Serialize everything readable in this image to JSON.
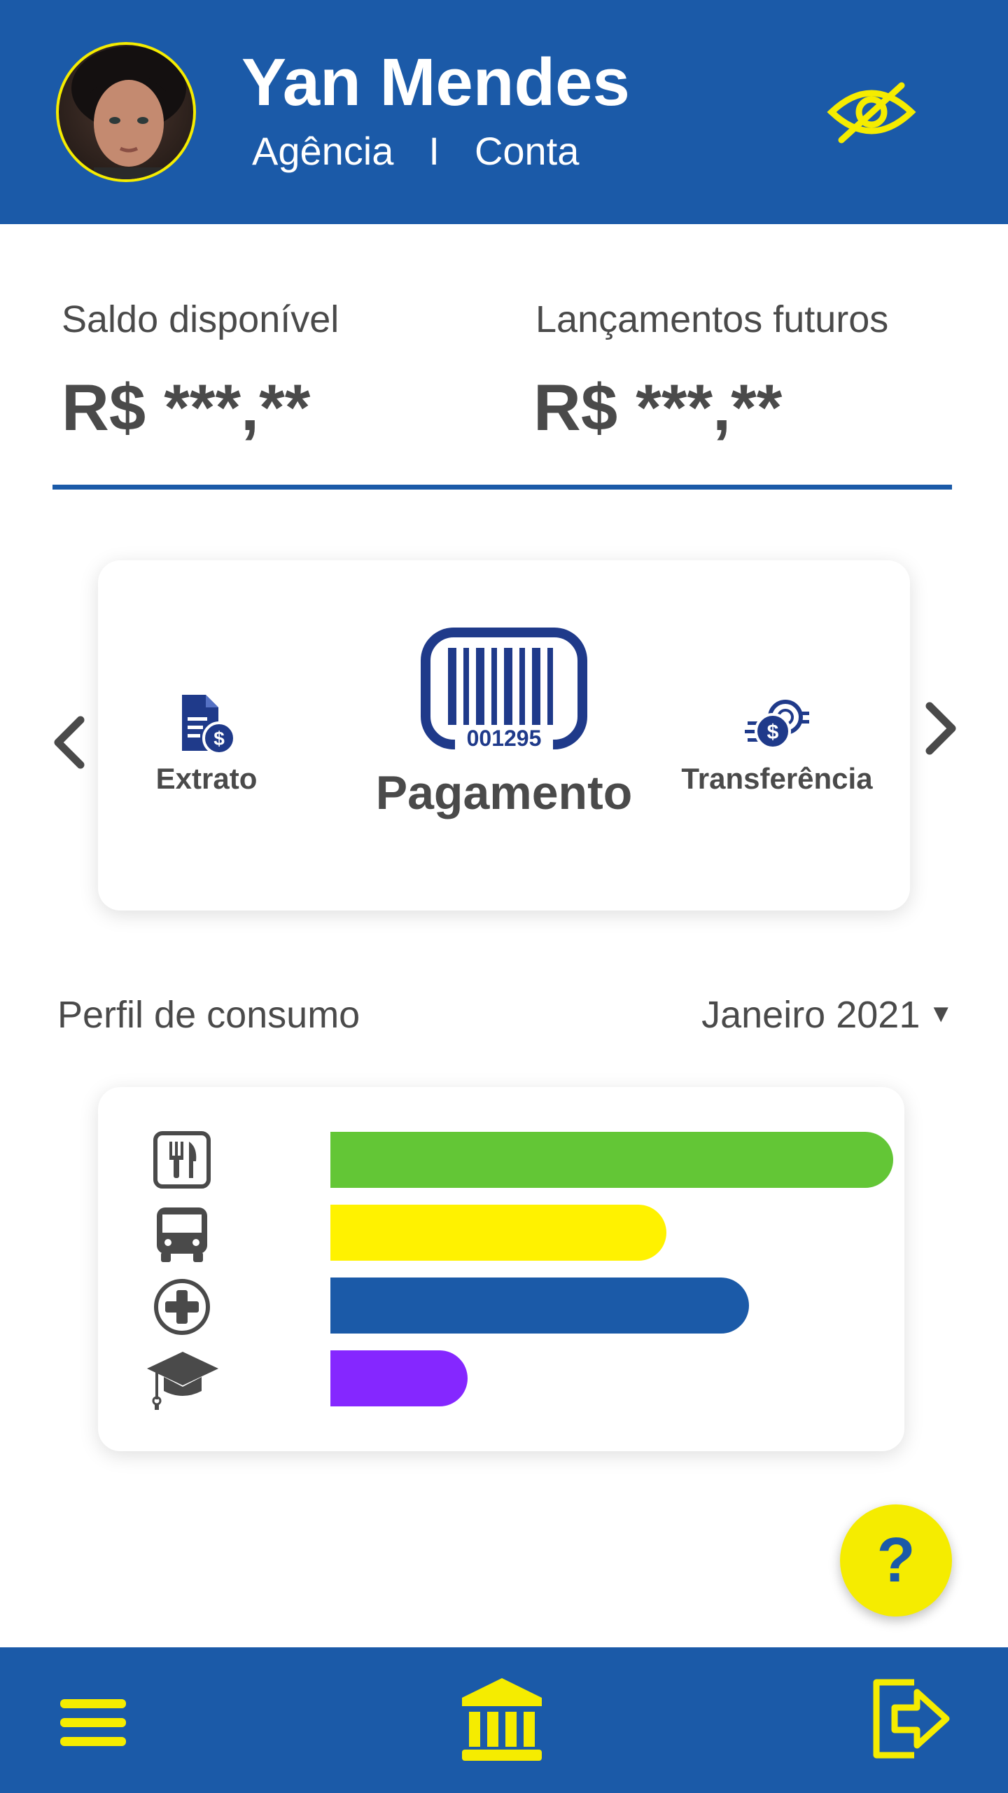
{
  "header": {
    "user_name": "Yan Mendes",
    "agency_label": "Agência",
    "separator": "I",
    "account_label": "Conta",
    "avatar_alt": "avatar",
    "visibility_icon": "eye-off-icon"
  },
  "balances": {
    "available": {
      "label": "Saldo disponível",
      "value": "R$ ***,**"
    },
    "future": {
      "label": "Lançamentos futuros",
      "value": "R$ ***,**"
    }
  },
  "actions": {
    "left_item": {
      "label": "Extrato",
      "icon": "statement-icon"
    },
    "center_item": {
      "label": "Pagamento",
      "icon": "barcode-icon",
      "barcode_number": "001295"
    },
    "right_item": {
      "label": "Transferência",
      "icon": "transfer-icon"
    }
  },
  "consumption": {
    "title": "Perfil de consumo",
    "period": "Janeiro 2021",
    "categories": [
      {
        "icon": "restaurant-icon",
        "color": "#63c636",
        "fraction": 0.82
      },
      {
        "icon": "bus-icon",
        "color": "#fff200",
        "fraction": 0.49
      },
      {
        "icon": "health-icon",
        "color": "#1b5aa8",
        "fraction": 0.61
      },
      {
        "icon": "education-icon",
        "color": "#8527ff",
        "fraction": 0.2
      }
    ]
  },
  "help": {
    "label": "?"
  },
  "bottom_nav": {
    "menu_icon": "menu-icon",
    "bank_icon": "bank-icon",
    "logout_icon": "logout-icon"
  },
  "colors": {
    "brand_blue": "#1b5aa8",
    "accent_yellow": "#f5ec00",
    "text_gray": "#4a4a4a"
  }
}
